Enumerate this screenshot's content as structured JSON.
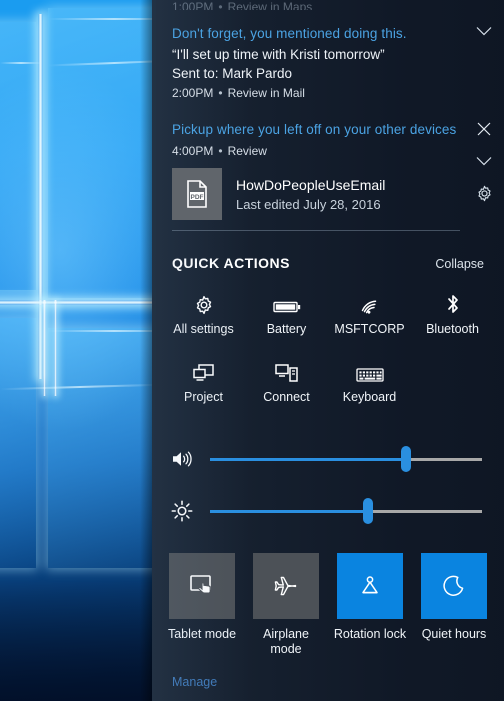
{
  "desktop": {
    "wallpaper_name": "windows-10-hero-wallpaper"
  },
  "action_center": {
    "notifications": [
      {
        "id": "cut-off",
        "clipped_text": "1:00PM",
        "clipped_sep": "•",
        "clipped_action": "Review in Maps"
      },
      {
        "id": "cortana-reminder",
        "title": "Don't forget, you mentioned doing this.",
        "quote": "“I'll set up time with Kristi tomorrow”",
        "recipient": "Sent to: Mark Pardo",
        "time": "2:00PM",
        "separator": "•",
        "action": "Review in Mail",
        "expand_icon": "chevron-down-icon"
      },
      {
        "id": "pickup-where-left-off",
        "title": "Pickup where you left off on your other devices",
        "time": "4:00PM",
        "separator": "•",
        "action": "Review",
        "close_icon": "close-icon",
        "expand_icon": "chevron-down-icon",
        "settings_icon": "gear-icon",
        "attachment": {
          "thumb_icon": "pdf-file-icon",
          "name": "HowDoPeopleUseEmail",
          "subtitle": "Last edited July 28, 2016"
        }
      }
    ],
    "quick_actions": {
      "header": "QUICK ACTIONS",
      "collapse_label": "Collapse",
      "items": [
        {
          "label": "All settings",
          "icon": "gear-icon"
        },
        {
          "label": "Battery",
          "icon": "battery-icon"
        },
        {
          "label": "MSFTCORP",
          "icon": "wifi-icon"
        },
        {
          "label": "Bluetooth",
          "icon": "bluetooth-icon"
        },
        {
          "label": "Project",
          "icon": "project-screen-icon"
        },
        {
          "label": "Connect",
          "icon": "connect-devices-icon"
        },
        {
          "label": "Keyboard",
          "icon": "keyboard-icon"
        }
      ]
    },
    "sliders": [
      {
        "name": "volume",
        "icon": "volume-icon",
        "value": 72
      },
      {
        "name": "brightness",
        "icon": "brightness-icon",
        "value": 58
      }
    ],
    "tiles": [
      {
        "label": "Tablet mode",
        "icon": "tablet-mode-icon",
        "state": "off"
      },
      {
        "label": "Airplane mode",
        "icon": "airplane-icon",
        "state": "off"
      },
      {
        "label": "Rotation lock",
        "icon": "rotation-lock-icon",
        "state": "on"
      },
      {
        "label": "Quiet hours",
        "icon": "moon-icon",
        "state": "on"
      }
    ],
    "footer": {
      "manage_label": "Manage"
    },
    "colors": {
      "accent": "#0a84e0",
      "link": "#4ba3e3",
      "manage_link": "#3f79b8",
      "tile_off": "#4c5157",
      "panel_bg": "#101826",
      "slider_fill": "#2a8fe0",
      "slider_track": "#a8a8a8"
    }
  }
}
